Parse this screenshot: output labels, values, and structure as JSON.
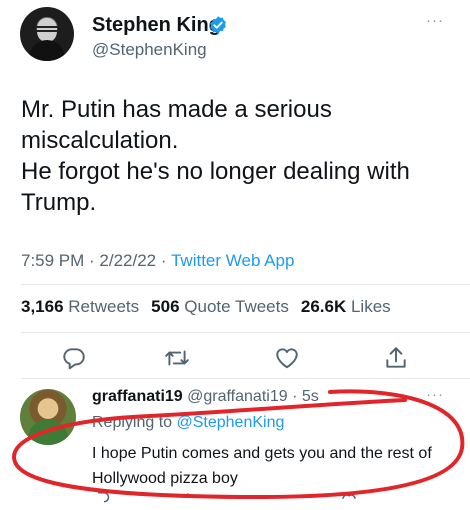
{
  "author": {
    "name": "Stephen King",
    "handle": "@StephenKing",
    "verified": true
  },
  "tweet": {
    "lines": [
      "Mr. Putin has made a serious",
      "miscalculation.",
      "He forgot he's no longer dealing with",
      "Trump."
    ],
    "time": "7:59 PM",
    "date": "2/22/22",
    "separator": " · ",
    "source": "Twitter Web App"
  },
  "stats": {
    "retweets_count": "3,166",
    "retweets_label": "Retweets",
    "quotes_count": "506",
    "quotes_label": "Quote Tweets",
    "likes_count": "26.6K",
    "likes_label": "Likes"
  },
  "more_icon": "···",
  "reply": {
    "name": "graffanati19",
    "handle": "@graffanati19",
    "age": "· 5s",
    "replying_prefix": "Replying to ",
    "replying_to": "@StephenKing",
    "text": "I hope Putin comes and gets you and the rest of Hollywood pizza boy"
  },
  "icons": [
    "reply-icon",
    "retweet-icon",
    "like-icon",
    "share-icon",
    "verified-badge-icon",
    "more-icon"
  ],
  "colors": {
    "accent": "#1d9bf0",
    "secondary_text": "#536471",
    "annotation_red": "#e0262a"
  }
}
